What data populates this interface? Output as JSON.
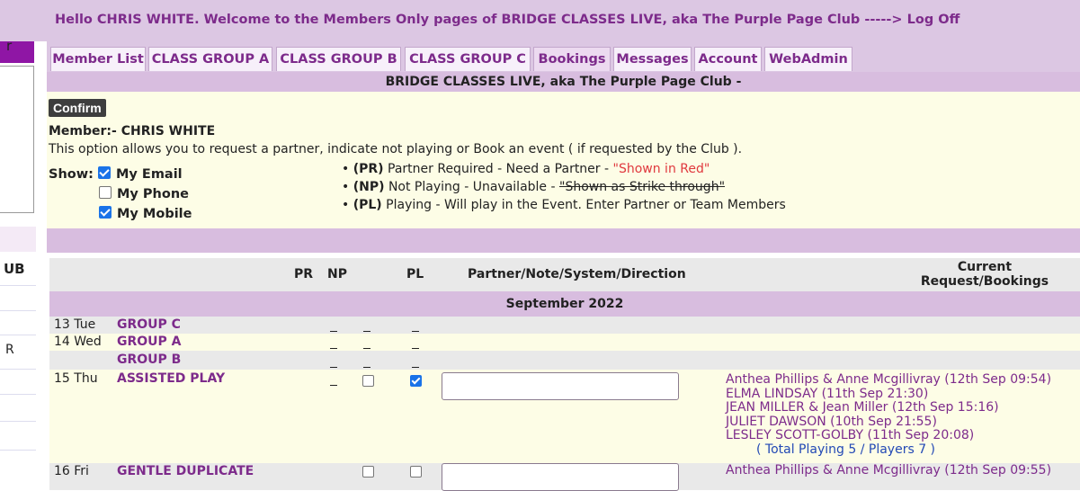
{
  "sidebar": {
    "fragment_top": "r",
    "fragment_club": "UB",
    "fragment_mid": "R"
  },
  "header": {
    "welcome_prefix": "Hello CHRIS WHITE. Welcome to the Members Only pages of BRIDGE CLASSES LIVE, aka The Purple Page Club ----->",
    "logoff_label": "Log Off"
  },
  "tabs": [
    {
      "label": "Member List"
    },
    {
      "label": "CLASS GROUP A"
    },
    {
      "label": "CLASS GROUP B"
    },
    {
      "label": "CLASS GROUP C"
    },
    {
      "label": "Bookings"
    },
    {
      "label": "Messages"
    },
    {
      "label": "Account"
    },
    {
      "label": "WebAdmin"
    }
  ],
  "active_tab": "Bookings",
  "club_bar": "BRIDGE CLASSES LIVE, aka The Purple Page Club -",
  "panel": {
    "confirm_label": "Confirm",
    "member_label": "Member:- CHRIS WHITE",
    "option_text": "This option allows you to request a partner, indicate not playing or Book an event ( if requested by the Club ).",
    "show_label": "Show:",
    "show_options": [
      {
        "label": "My Email",
        "checked": true
      },
      {
        "label": "My Phone",
        "checked": false
      },
      {
        "label": "My Mobile",
        "checked": true
      }
    ],
    "legend": [
      {
        "code": "(PR)",
        "text": "Partner Required - Need a Partner -",
        "note": "\"Shown in Red\""
      },
      {
        "code": "(NP)",
        "text": "Not Playing - Unavailable -",
        "note": "\"Shown as Strike through\""
      },
      {
        "code": "(PL)",
        "text": "Playing - Will play in the Event. Enter Partner or Team Members",
        "note": ""
      }
    ]
  },
  "table": {
    "headers": {
      "pr": "PR",
      "np": "NP",
      "pl": "PL",
      "partner": "Partner/Note/System/Direction",
      "current_line1": "Current",
      "current_line2": "Request/Bookings"
    },
    "month": "September 2022",
    "rows": [
      {
        "day": "13 Tue",
        "event": "GROUP C"
      },
      {
        "day": "14 Wed",
        "event": "GROUP A"
      },
      {
        "day": "",
        "event": "GROUP B"
      },
      {
        "day": "15 Thu",
        "event": "ASSISTED PLAY",
        "np_checked": false,
        "pl_checked": true,
        "partner_value": "",
        "bookings": [
          "Anthea Phillips & Anne Mcgillivray (12th Sep 09:54)",
          "ELMA LINDSAY (11th Sep 21:30)",
          "JEAN MILLER & Jean Miller (12th Sep 15:16)",
          "JULIET DAWSON (10th Sep 21:55)",
          "LESLEY SCOTT-GOLBY (11th Sep 20:08)"
        ],
        "total": "( Total Playing 5 / Players 7 )"
      },
      {
        "day": "16 Fri",
        "event": "GENTLE DUPLICATE",
        "np_checked": false,
        "pl_checked": false,
        "partner_value": "",
        "bookings": [
          "Anthea Phillips & Anne Mcgillivray (12th Sep 09:55)"
        ]
      }
    ]
  },
  "colors": {
    "purple_text": "#7d2b8b",
    "header_bg": "#dcc7e3",
    "panel_bg": "#fdfde6",
    "pr_red": "#e0393e",
    "total_blue": "#2349b5",
    "checkbox_blue": "#1a73e8"
  }
}
